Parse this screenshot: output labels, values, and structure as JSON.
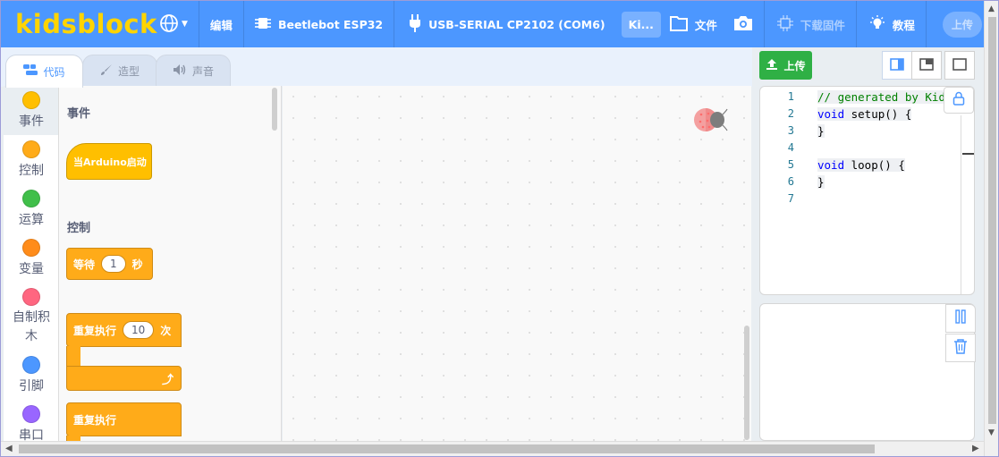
{
  "menubar": {
    "logo": "kidsblock",
    "language_icon": "globe-icon",
    "edit": "编辑",
    "board": "Beetlebot ESP32",
    "port": "USB-SERIAL CP2102 (COM6)",
    "mode_short": "Ki...",
    "file": "文件",
    "firmware": "下载固件",
    "tutorial": "教程",
    "upload_pill": "上传",
    "colors": {
      "bar": "#4c97ff",
      "logo": "#ffd400"
    }
  },
  "tabs": [
    {
      "label": "代码",
      "icon": "code-icon",
      "active": true
    },
    {
      "label": "造型",
      "icon": "brush-icon",
      "active": false
    },
    {
      "label": "声音",
      "icon": "speaker-icon",
      "active": false
    }
  ],
  "categories": [
    {
      "label": "事件",
      "color": "#ffbf00"
    },
    {
      "label": "控制",
      "color": "#ffab19"
    },
    {
      "label": "运算",
      "color": "#40bf4a"
    },
    {
      "label": "变量",
      "color": "#ff8c1a"
    },
    {
      "label": "自制积木",
      "color": "#ff6680"
    },
    {
      "label": "引脚",
      "color": "#4c97ff"
    },
    {
      "label": "串口",
      "color": "#9966ff"
    }
  ],
  "flyout": {
    "section_events": "事件",
    "block_when_start": "当Arduino启动",
    "section_control": "控制",
    "block_wait_prefix": "等待",
    "block_wait_value": "1",
    "block_wait_suffix": "秒",
    "block_repeat_prefix": "重复执行",
    "block_repeat_value": "10",
    "block_repeat_suffix": "次",
    "block_forever": "重复执行"
  },
  "right": {
    "upload_button": "上传",
    "code_lines": [
      "1",
      "2",
      "3",
      "4",
      "5",
      "6",
      "7"
    ],
    "code": {
      "l1": "// generated by Kid",
      "l2_kw": "void",
      "l2_rest": " setup() {",
      "l3": "}",
      "l5_kw": "void",
      "l5_rest": " loop() {",
      "l6": "}"
    }
  }
}
